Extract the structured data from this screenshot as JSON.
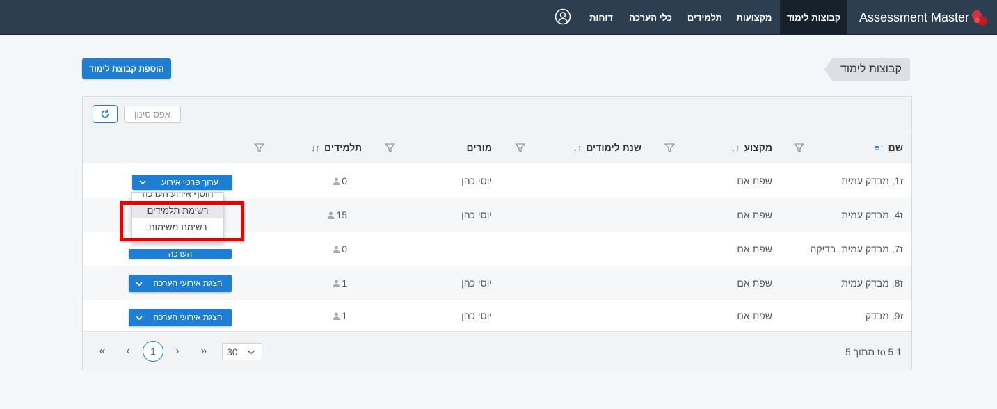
{
  "app": {
    "name": "Assessment Master"
  },
  "nav": {
    "items": [
      {
        "label": "קבוצות לימוד",
        "active": true
      },
      {
        "label": "מקצועות"
      },
      {
        "label": "תלמידים"
      },
      {
        "label": "כלי הערכה"
      },
      {
        "label": "דוחות"
      }
    ]
  },
  "page": {
    "title": "קבוצות לימוד",
    "add_button": "הוספת קבוצת לימוד",
    "reset_filter": "אפס סינון"
  },
  "table": {
    "columns": [
      "שם",
      "מקצוע",
      "שנת לימודים",
      "מורים",
      "תלמידים"
    ],
    "rows": [
      {
        "name": "ז1, מבדק עמית",
        "subject": "שפת אם",
        "year": "",
        "teachers": "יוסי כהן",
        "students": "0",
        "action": "ערוך פרטי אירוע"
      },
      {
        "name": "ז4, מבדק עמית",
        "subject": "שפת אם",
        "year": "",
        "teachers": "יוסי כהן",
        "students": "15",
        "action": ""
      },
      {
        "name": "ז7, מבדק עמית, בדיקה",
        "subject": "שפת אם",
        "year": "",
        "teachers": "",
        "students": "0",
        "action": "הערכה"
      },
      {
        "name": "ז8, מבדק עמית",
        "subject": "שפת אם",
        "year": "",
        "teachers": "יוסי כהן",
        "students": "1",
        "action": "הצגת אירועי הערכה"
      },
      {
        "name": "ז9, מבדק",
        "subject": "שפת אם",
        "year": "",
        "teachers": "יוסי כהן",
        "students": "1",
        "action": "הצגת אירועי הערכה"
      }
    ],
    "dropdown": {
      "items": [
        "הוסף אירוע הערכה",
        "רשימת תלמידים",
        "רשימת משימות"
      ],
      "highlighted": "רשימת תלמידים"
    }
  },
  "pagination": {
    "first": "«",
    "prev": "‹",
    "current_page": "1",
    "next": "›",
    "last": "»",
    "page_size": "30",
    "count_text": "1 to 5 מתוך 5"
  },
  "colors": {
    "navbar": "#2d3e50",
    "accent": "#1d7ed4",
    "highlight": "#ee0000"
  }
}
